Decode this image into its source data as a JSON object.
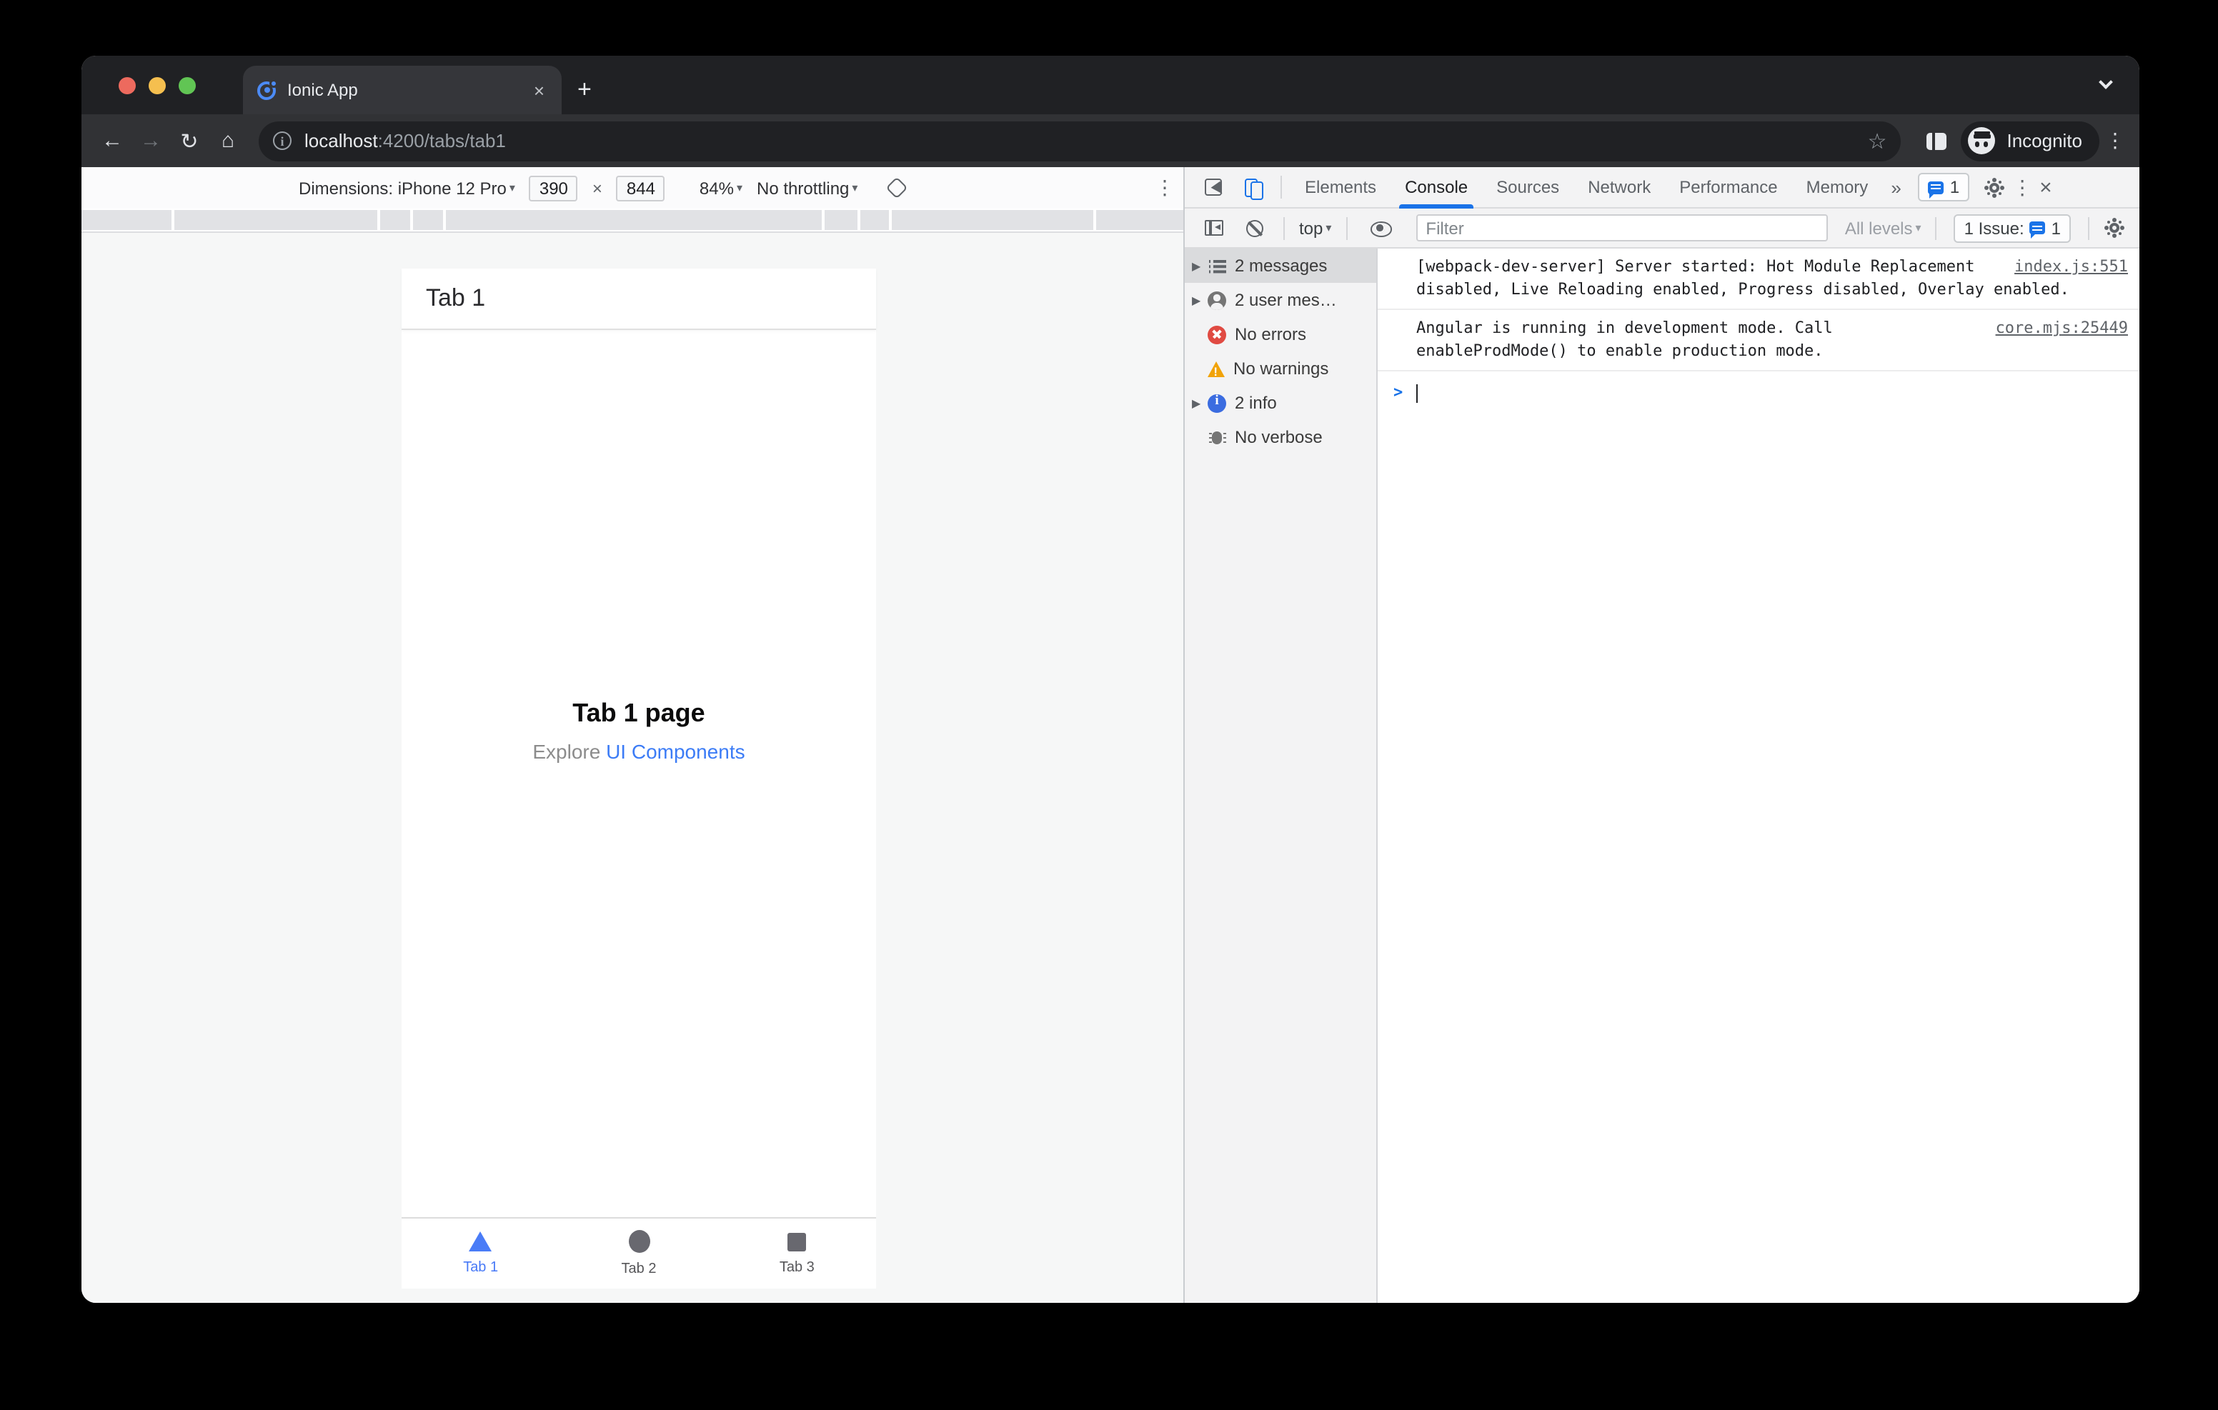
{
  "browser": {
    "tab_title": "Ionic App",
    "url_host": "localhost",
    "url_path": ":4200/tabs/tab1",
    "incognito_label": "Incognito"
  },
  "glyphs": {
    "back": "←",
    "forward": "→",
    "reload": "↻",
    "home": "⌂",
    "star": "☆",
    "kebab": "⋮",
    "plus": "+",
    "close_tab": "×",
    "close_devtools": "×",
    "more_tabs": "»",
    "caret_down": "▾",
    "expand_arrow": "▶",
    "info_i": "i",
    "prompt": ">"
  },
  "device_toolbar": {
    "dimensions_label": "Dimensions: iPhone 12 Pro",
    "width_value": "390",
    "x_separator": "×",
    "height_value": "844",
    "zoom_value": "84%",
    "throttling_value": "No throttling"
  },
  "devtools": {
    "tabs": [
      {
        "label": "Elements"
      },
      {
        "label": "Console"
      },
      {
        "label": "Sources"
      },
      {
        "label": "Network"
      },
      {
        "label": "Performance"
      },
      {
        "label": "Memory"
      }
    ],
    "active_tab": "Console",
    "issues_count_top": "1",
    "console_toolbar": {
      "context_selector": "top",
      "filter_placeholder": "Filter",
      "levels_label": "All levels",
      "issue_label": "1 Issue:",
      "issue_count": "1"
    },
    "sidebar": [
      {
        "label": "2 messages",
        "icon": "list-icon",
        "selected": true
      },
      {
        "label": "2 user mes…",
        "icon": "user-icon"
      },
      {
        "label": "No errors",
        "icon": "error-icon"
      },
      {
        "label": "No warnings",
        "icon": "warning-icon"
      },
      {
        "label": "2 info",
        "icon": "info-icon"
      },
      {
        "label": "No verbose",
        "icon": "bug-icon"
      }
    ],
    "messages": [
      {
        "text": "[webpack-dev-server] Server started: Hot Module Replacement disabled, Live Reloading enabled, Progress disabled, Overlay enabled.",
        "source": "index.js:551"
      },
      {
        "text": "Angular is running in development mode. Call enableProdMode() to enable production mode.",
        "source": "core.mjs:25449"
      }
    ]
  },
  "app": {
    "header_title": "Tab 1",
    "page_title": "Tab 1 page",
    "explore_text": "Explore",
    "explore_link": "UI Components",
    "tabs": [
      {
        "label": "Tab 1",
        "icon": "triangle",
        "active": true
      },
      {
        "label": "Tab 2",
        "icon": "ellipse",
        "active": false
      },
      {
        "label": "Tab 3",
        "icon": "square",
        "active": false
      }
    ]
  },
  "colors": {
    "accent_blue": "#1a73e8",
    "ionic_blue": "#3880ff",
    "error_red": "#e04a42",
    "warning_amber": "#f1a30a",
    "dark_chrome": "#202124"
  }
}
